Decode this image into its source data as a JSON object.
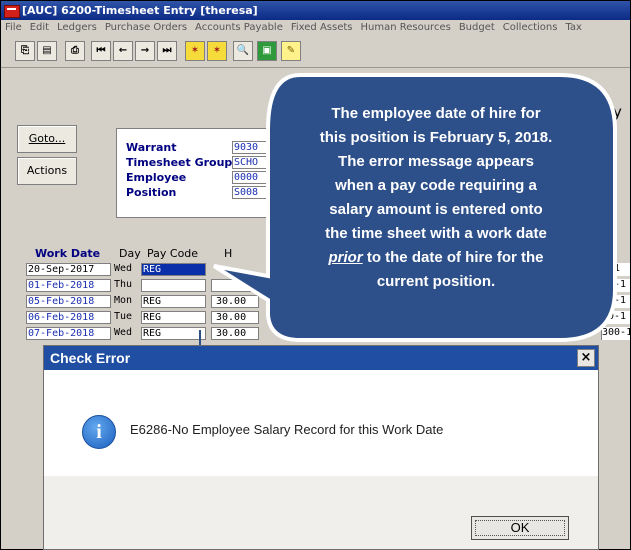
{
  "window": {
    "title": "[AUC] 6200-Timesheet Entry [theresa]"
  },
  "menu": [
    "File",
    "Edit",
    "Ledgers",
    "Purchase Orders",
    "Accounts Payable",
    "Fixed Assets",
    "Human Resources",
    "Budget",
    "Collections",
    "Tax"
  ],
  "toolbar": {
    "icons": [
      "copy-icon",
      "paste-icon",
      "print-icon",
      "first-record-icon",
      "prev-record-icon",
      "next-record-icon",
      "last-record-icon",
      "find-icon",
      "save-icon",
      "search-icon",
      "export-icon",
      "note-icon"
    ]
  },
  "buttons": {
    "goto": "Goto...",
    "actions": "Actions"
  },
  "header_fields": [
    {
      "label": "Warrant",
      "value": "9030"
    },
    {
      "label": "Timesheet Group",
      "value": "SCHO"
    },
    {
      "label": "Employee",
      "value": "0000"
    },
    {
      "label": "Position",
      "value": "S008"
    }
  ],
  "grid": {
    "columns": {
      "work_date": "Work Date",
      "day": "Day",
      "pay_code": "Pay Code",
      "hours": "H"
    },
    "rows": [
      {
        "date": "20-Sep-2017",
        "day": "Wed",
        "pay_code": "REG",
        "hours": ""
      },
      {
        "date": "01-Feb-2018",
        "day": "Thu",
        "pay_code": "",
        "hours": ""
      },
      {
        "date": "05-Feb-2018",
        "day": "Mon",
        "pay_code": "REG",
        "hours": "30.00"
      },
      {
        "date": "06-Feb-2018",
        "day": "Tue",
        "pay_code": "REG",
        "hours": "30.00"
      },
      {
        "date": "07-Feb-2018",
        "day": "Wed",
        "pay_code": "REG",
        "hours": "30.00"
      }
    ],
    "right_col": [
      "0-1",
      "00-1",
      "00-1",
      "00-1",
      "300-1"
    ]
  },
  "callout": {
    "lines": [
      "The employee date of hire for",
      "this position is February 5, 2018.",
      "The error message appears",
      "when a pay code requiring a",
      "salary amount is entered onto",
      "the time sheet with a work date",
      "prior",
      " to the date of hire for the",
      "current position."
    ]
  },
  "dialog": {
    "title": "Check Error",
    "message": "E6286-No Employee Salary Record for this Work Date",
    "ok_label": "OK",
    "close_label": "×"
  },
  "colors": {
    "callout_fill": "#2d4f8a",
    "dialog_title": "#1f4ea3",
    "selection": "#0a2fa8"
  }
}
